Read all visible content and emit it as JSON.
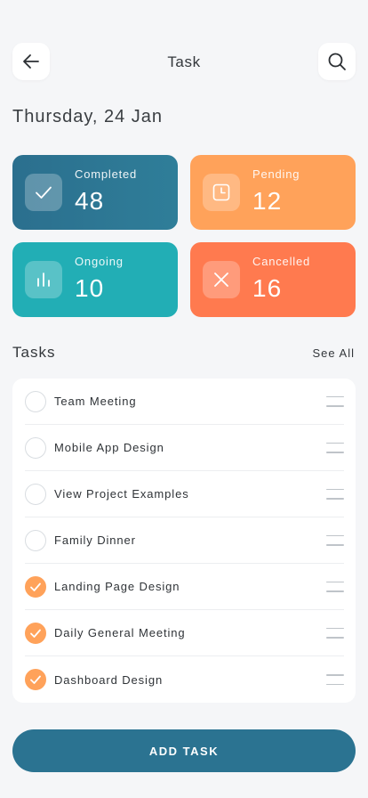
{
  "header": {
    "title": "Task",
    "back_icon": "arrow-left-icon",
    "search_icon": "search-icon"
  },
  "date": "Thursday, 24 Jan",
  "stats": {
    "completed": {
      "label": "Completed",
      "count": "48",
      "icon": "check-icon",
      "color": "#2b6f8e"
    },
    "pending": {
      "label": "Pending",
      "count": "12",
      "icon": "clock-icon",
      "color": "#ffa25a"
    },
    "ongoing": {
      "label": "Ongoing",
      "count": "10",
      "icon": "bar-chart-icon",
      "color": "#22aeb5"
    },
    "cancelled": {
      "label": "Cancelled",
      "count": "16",
      "icon": "close-icon",
      "color": "#ff7a4f"
    }
  },
  "tasks_section": {
    "title": "Tasks",
    "see_all": "See All",
    "items": [
      {
        "name": "Team Meeting",
        "done": false
      },
      {
        "name": "Mobile App Design",
        "done": false
      },
      {
        "name": "View Project Examples",
        "done": false
      },
      {
        "name": "Family Dinner",
        "done": false
      },
      {
        "name": "Landing Page Design",
        "done": true
      },
      {
        "name": "Daily General Meeting",
        "done": true
      },
      {
        "name": "Dashboard Design",
        "done": true
      }
    ]
  },
  "add_task_label": "ADD TASK"
}
